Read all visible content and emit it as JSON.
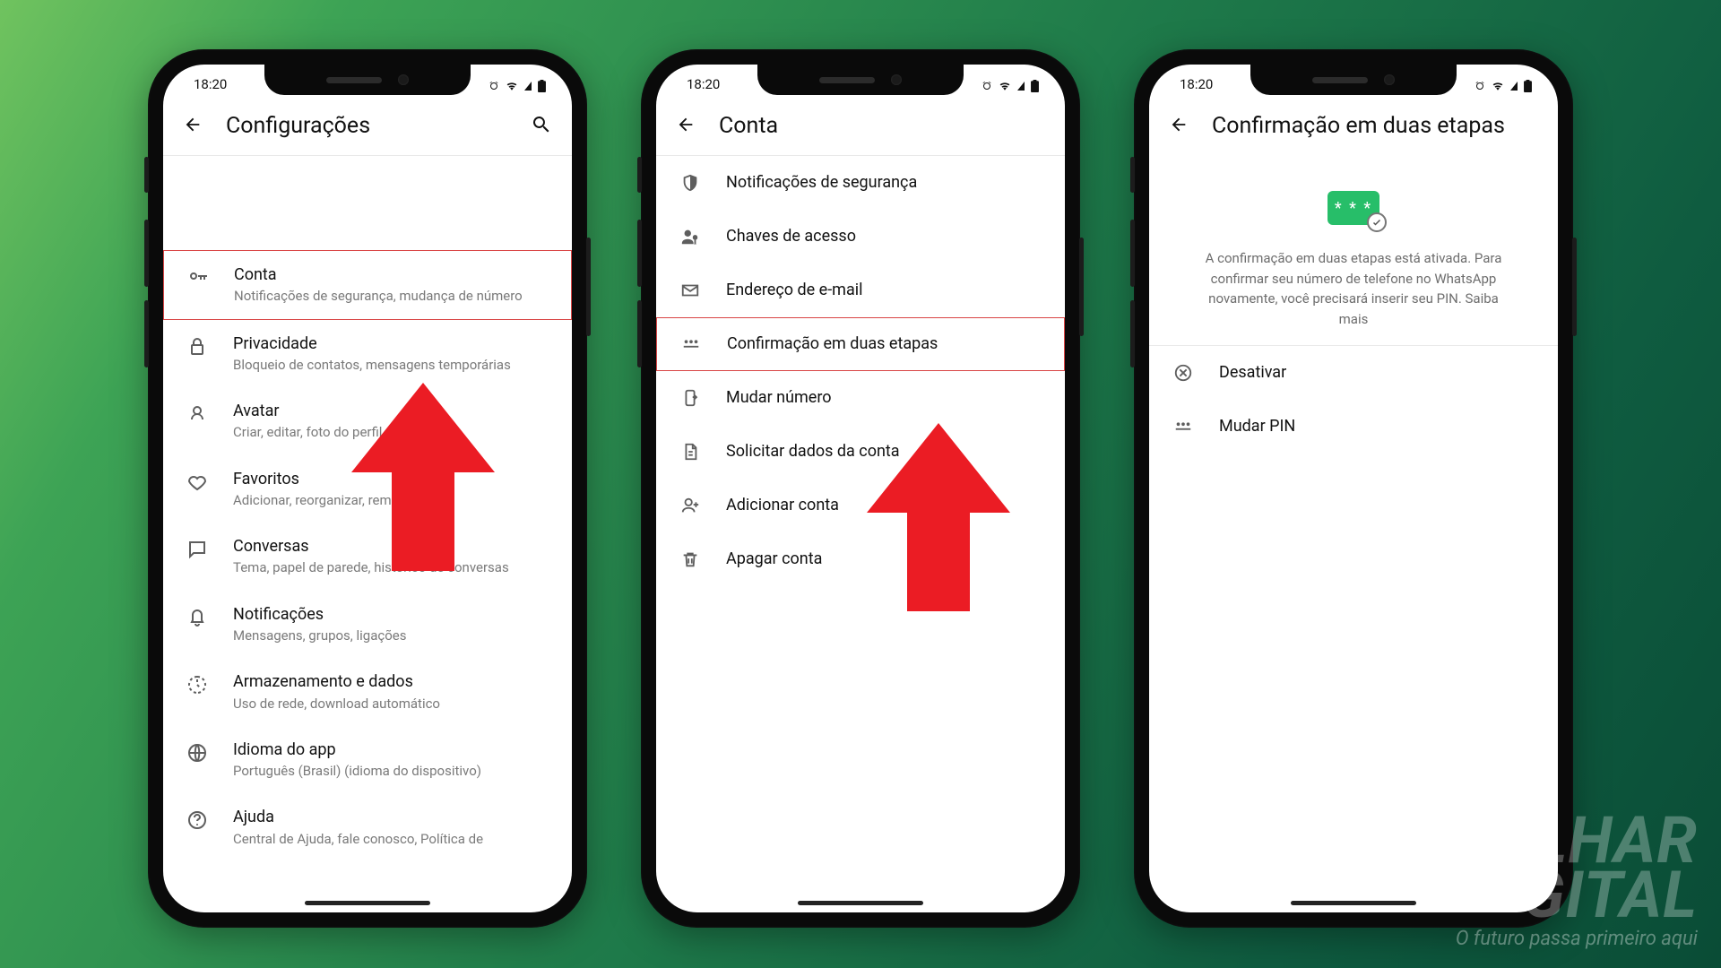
{
  "status": {
    "time": "18:20"
  },
  "watermark": {
    "line1": "LHAR",
    "line2": "GITAL",
    "tagline": "O futuro passa primeiro aqui"
  },
  "phone1": {
    "title": "Configurações",
    "items": [
      {
        "label": "Conta",
        "sub": "Notificações de segurança, mudança de número"
      },
      {
        "label": "Privacidade",
        "sub": "Bloqueio de contatos, mensagens temporárias"
      },
      {
        "label": "Avatar",
        "sub": "Criar, editar, foto do perfil"
      },
      {
        "label": "Favoritos",
        "sub": "Adicionar, reorganizar, remover"
      },
      {
        "label": "Conversas",
        "sub": "Tema, papel de parede, histórico de conversas"
      },
      {
        "label": "Notificações",
        "sub": "Mensagens, grupos, ligações"
      },
      {
        "label": "Armazenamento e dados",
        "sub": "Uso de rede, download automático"
      },
      {
        "label": "Idioma do app",
        "sub": "Português (Brasil) (idioma do dispositivo)"
      },
      {
        "label": "Ajuda",
        "sub": "Central de Ajuda, fale conosco, Política de"
      }
    ]
  },
  "phone2": {
    "title": "Conta",
    "items": [
      {
        "label": "Notificações de segurança"
      },
      {
        "label": "Chaves de acesso"
      },
      {
        "label": "Endereço de e-mail"
      },
      {
        "label": "Confirmação em duas etapas"
      },
      {
        "label": "Mudar número"
      },
      {
        "label": "Solicitar dados da conta"
      },
      {
        "label": "Adicionar conta"
      },
      {
        "label": "Apagar conta"
      }
    ]
  },
  "phone3": {
    "title": "Confirmação em duas etapas",
    "pin_placeholder": "* * *",
    "hero_text": "A confirmação em duas etapas está ativada. Para confirmar seu número de telefone no WhatsApp novamente, você precisará inserir seu PIN. Saiba mais",
    "items": [
      {
        "label": "Desativar"
      },
      {
        "label": "Mudar PIN"
      }
    ]
  }
}
